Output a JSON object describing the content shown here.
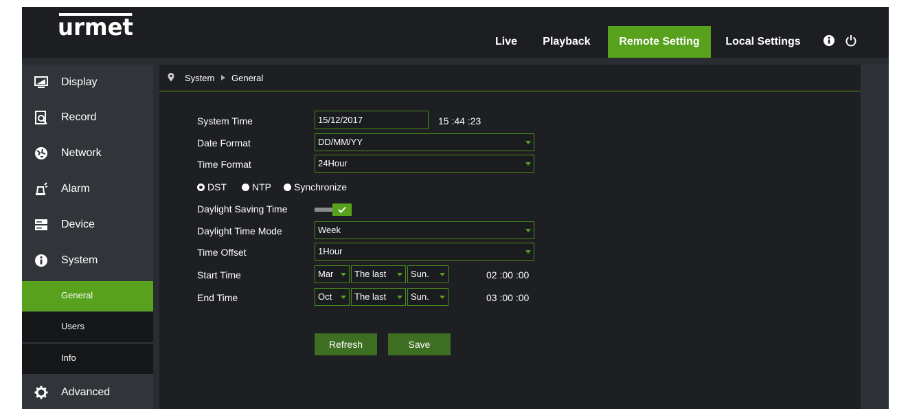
{
  "header": {
    "logo": "urmet",
    "nav": [
      "Live",
      "Playback",
      "Remote Setting",
      "Local Settings"
    ],
    "active_nav": "Remote Setting",
    "icons": [
      "info-icon",
      "power-icon"
    ],
    "accent_color": "#57a11c"
  },
  "sidebar": {
    "items": [
      {
        "label": "Display",
        "icon": "monitor-icon"
      },
      {
        "label": "Record",
        "icon": "record-icon"
      },
      {
        "label": "Network",
        "icon": "network-icon"
      },
      {
        "label": "Alarm",
        "icon": "alarm-icon"
      },
      {
        "label": "Device",
        "icon": "device-icon"
      },
      {
        "label": "System",
        "icon": "info-circle-icon"
      }
    ],
    "subitems": [
      "General",
      "Users",
      "Info"
    ],
    "active_subitem": "General",
    "advanced": {
      "label": "Advanced",
      "icon": "gear-icon"
    }
  },
  "breadcrumb": {
    "root": "System",
    "current": "General"
  },
  "form": {
    "system_time": {
      "label": "System Time",
      "date": "15/12/2017",
      "time": "15 :44 :23"
    },
    "date_format": {
      "label": "Date Format",
      "value": "DD/MM/YY"
    },
    "time_format": {
      "label": "Time Format",
      "value": "24Hour"
    },
    "radios": [
      "DST",
      "NTP",
      "Synchronize"
    ],
    "radio_selected": "DST",
    "dst": {
      "label": "Daylight Saving Time",
      "enabled": true
    },
    "dst_mode": {
      "label": "Daylight Time Mode",
      "value": "Week"
    },
    "time_offset": {
      "label": "Time Offset",
      "value": "1Hour"
    },
    "start_time": {
      "label": "Start Time",
      "month": "Mar",
      "week": "The last",
      "day": "Sun.",
      "time": "02 :00 :00"
    },
    "end_time": {
      "label": "End Time",
      "month": "Oct",
      "week": "The last",
      "day": "Sun.",
      "time": "03 :00 :00"
    }
  },
  "buttons": {
    "refresh": "Refresh",
    "save": "Save"
  }
}
